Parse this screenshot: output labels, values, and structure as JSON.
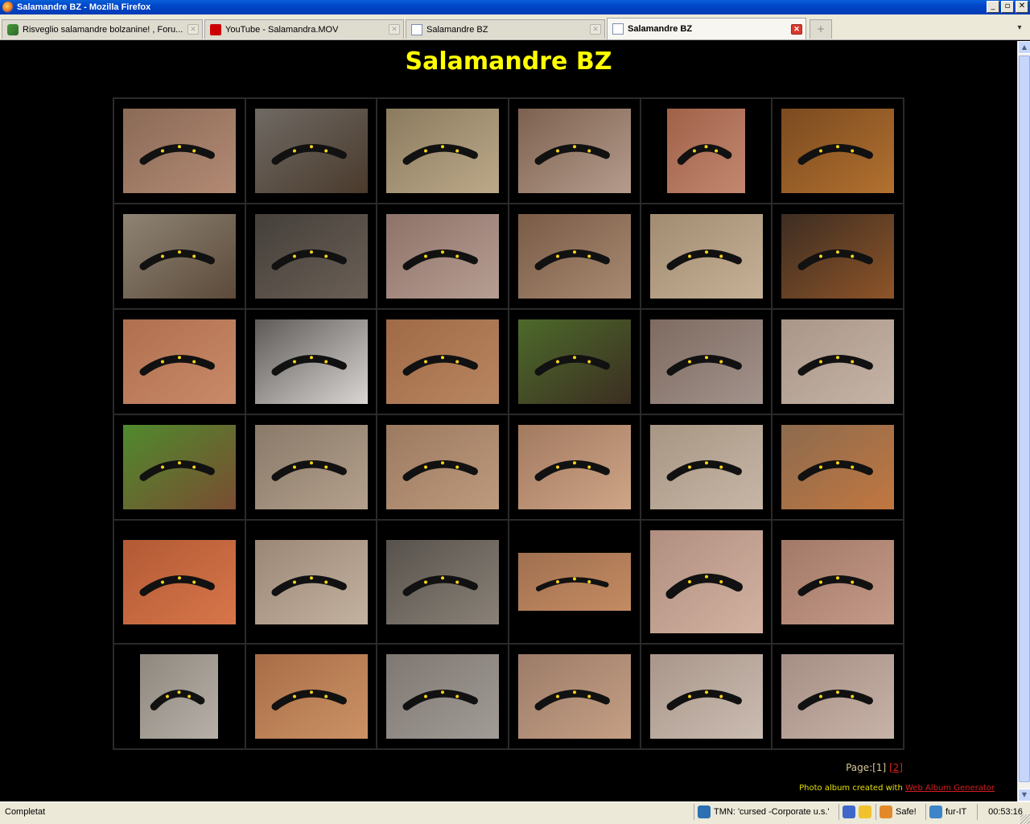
{
  "window": {
    "title": "Salamandre BZ - Mozilla Firefox"
  },
  "tabs": [
    {
      "label": "Risveglio salamandre bolzanine! , Foru...",
      "icon": "forum-icon",
      "active": false
    },
    {
      "label": "YouTube - Salamandra.MOV",
      "icon": "youtube-icon",
      "active": false
    },
    {
      "label": "Salamandre BZ",
      "icon": "page-icon",
      "active": false
    },
    {
      "label": "Salamandre BZ",
      "icon": "page-icon",
      "active": true
    }
  ],
  "page": {
    "title": "Salamandre BZ",
    "thumbnails": [
      {
        "orientation": "landscape",
        "palette": [
          "#8a6a56",
          "#b38a74",
          "#111"
        ]
      },
      {
        "orientation": "landscape",
        "palette": [
          "#6f6a64",
          "#4a3a2c",
          "#111"
        ]
      },
      {
        "orientation": "landscape",
        "palette": [
          "#8b7b5e",
          "#bca98a",
          "#111"
        ]
      },
      {
        "orientation": "landscape",
        "palette": [
          "#7d6150",
          "#b59c8c",
          "#111"
        ]
      },
      {
        "orientation": "portrait",
        "palette": [
          "#a06148",
          "#c38770",
          "#111"
        ]
      },
      {
        "orientation": "landscape",
        "palette": [
          "#7a4a20",
          "#b3712f",
          "#111"
        ]
      },
      {
        "orientation": "landscape",
        "palette": [
          "#8e8474",
          "#5c4a3a",
          "#111"
        ]
      },
      {
        "orientation": "landscape",
        "palette": [
          "#45403b",
          "#6a5f55",
          "#111"
        ]
      },
      {
        "orientation": "landscape",
        "palette": [
          "#8d7268",
          "#b79e93",
          "#111"
        ]
      },
      {
        "orientation": "landscape",
        "palette": [
          "#7a5b46",
          "#a88a72",
          "#111"
        ]
      },
      {
        "orientation": "landscape",
        "palette": [
          "#a18c72",
          "#c6b197",
          "#111"
        ]
      },
      {
        "orientation": "landscape",
        "palette": [
          "#3d2d22",
          "#8e5428",
          "#111"
        ]
      },
      {
        "orientation": "landscape",
        "palette": [
          "#b0704f",
          "#c98a69",
          "#111"
        ]
      },
      {
        "orientation": "landscape",
        "palette": [
          "#5e5a57",
          "#d9d6d3",
          "#111"
        ]
      },
      {
        "orientation": "landscape",
        "palette": [
          "#9f6a45",
          "#b98662",
          "#111"
        ]
      },
      {
        "orientation": "landscape",
        "palette": [
          "#4c6a2a",
          "#3c2e22",
          "#111"
        ]
      },
      {
        "orientation": "landscape",
        "palette": [
          "#7e6a60",
          "#a2938c",
          "#111"
        ]
      },
      {
        "orientation": "landscape",
        "palette": [
          "#a99688",
          "#c6b4a6",
          "#111"
        ]
      },
      {
        "orientation": "landscape",
        "palette": [
          "#4f8a2d",
          "#7a4d32",
          "#111"
        ]
      },
      {
        "orientation": "landscape",
        "palette": [
          "#8a7a6a",
          "#b4a08c",
          "#111"
        ]
      },
      {
        "orientation": "landscape",
        "palette": [
          "#9c7a60",
          "#bd9a7d",
          "#111"
        ]
      },
      {
        "orientation": "landscape",
        "palette": [
          "#a27a60",
          "#cfa587",
          "#111"
        ]
      },
      {
        "orientation": "landscape",
        "palette": [
          "#a89684",
          "#c7b6a6",
          "#111"
        ]
      },
      {
        "orientation": "landscape",
        "palette": [
          "#8c6b4e",
          "#c27740",
          "#111"
        ]
      },
      {
        "orientation": "landscape",
        "palette": [
          "#b25a35",
          "#d8764a",
          "#111"
        ]
      },
      {
        "orientation": "landscape",
        "palette": [
          "#9b8776",
          "#c4b2a0",
          "#111"
        ]
      },
      {
        "orientation": "landscape",
        "palette": [
          "#57524c",
          "#8a8278",
          "#111"
        ]
      },
      {
        "orientation": "landscape-wide",
        "palette": [
          "#a07050",
          "#c48b62",
          "#111"
        ]
      },
      {
        "orientation": "portrait-tall",
        "palette": [
          "#b08f80",
          "#d3b2a2",
          "#111"
        ]
      },
      {
        "orientation": "landscape",
        "palette": [
          "#a27866",
          "#c59a88",
          "#111"
        ]
      },
      {
        "orientation": "portrait",
        "palette": [
          "#8f887f",
          "#b6b0a8",
          "#111"
        ]
      },
      {
        "orientation": "landscape",
        "palette": [
          "#a86d46",
          "#cc9266",
          "#111"
        ]
      },
      {
        "orientation": "landscape",
        "palette": [
          "#7f7872",
          "#a29c96",
          "#111"
        ]
      },
      {
        "orientation": "landscape",
        "palette": [
          "#9c7c68",
          "#c59f85",
          "#111"
        ]
      },
      {
        "orientation": "landscape",
        "palette": [
          "#a9968a",
          "#cbbcb1",
          "#111"
        ]
      },
      {
        "orientation": "landscape",
        "palette": [
          "#a58e84",
          "#c8b3a9",
          "#111"
        ]
      }
    ],
    "pager": {
      "label": "Page:",
      "current": "[1]",
      "next": "[2]"
    },
    "credit": {
      "text": "Photo album created with ",
      "link": "Web Album Generator"
    }
  },
  "statusbar": {
    "status": "Completat",
    "tmn": "TMN: 'cursed -Corporate u.s.'",
    "safe": "Safe!",
    "locale": "fur-IT",
    "time": "00:53:16"
  },
  "colors": {
    "title": "#ffff00",
    "link": "#d61e1e",
    "page_bg": "#000000"
  }
}
